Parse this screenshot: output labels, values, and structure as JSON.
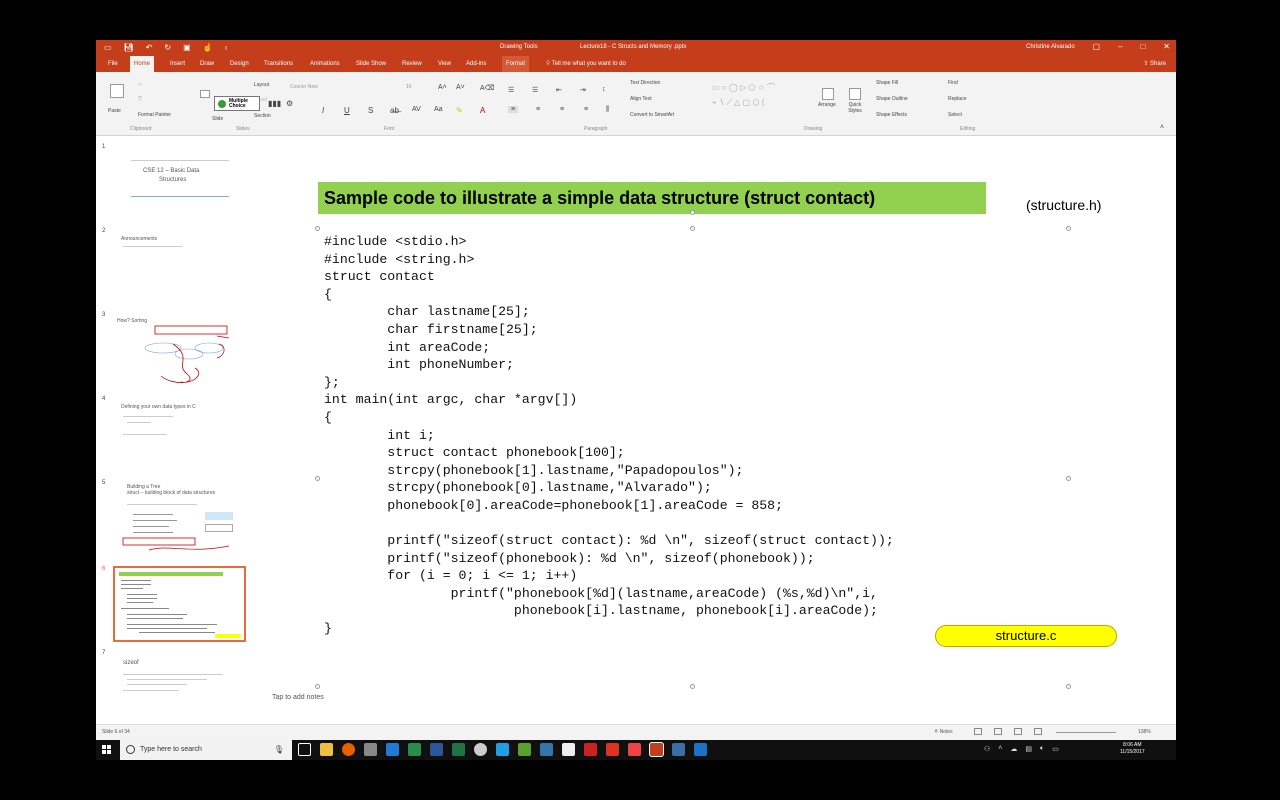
{
  "window": {
    "context_tab_label": "Drawing Tools",
    "title": "Lecture18 - C Structs and Memory .pptx",
    "user": "Christine Alvarado"
  },
  "tabs": [
    "File",
    "Home",
    "Insert",
    "Draw",
    "Design",
    "Transitions",
    "Animations",
    "Slide Show",
    "Review",
    "View",
    "Add-ins",
    "Format"
  ],
  "tell_me": "Tell me what you want to do",
  "share_label": "Share",
  "ribbon": {
    "paste": "Paste",
    "format_painter": "Format Painter",
    "layout": "Layout",
    "reset": "Reset",
    "section": "Section",
    "new_slide": "Slide",
    "multiple_choice": "Multiple Choice",
    "font_name": "Courier New",
    "font_size": "16",
    "text_direction": "Text Direction",
    "align_text": "Align Text",
    "convert_smartart": "Convert to SmartArt",
    "arrange": "Arrange",
    "quick_styles": "Quick Styles",
    "shape_fill": "Shape Fill",
    "shape_outline": "Shape Outline",
    "shape_effects": "Shape Effects",
    "find": "Find",
    "replace": "Replace",
    "select": "Select",
    "groups": [
      "Clipboard",
      "Slides",
      "Font",
      "Paragraph",
      "Drawing",
      "Editing"
    ]
  },
  "thumbnails": [
    {
      "num": "1",
      "lines": [
        "CSE 12 – Basic Data",
        "Structures"
      ]
    },
    {
      "num": "2",
      "lines": [
        "Announcements"
      ]
    },
    {
      "num": "3",
      "lines": [
        "How? Sorting"
      ]
    },
    {
      "num": "4",
      "lines": [
        "Defining your own data types in C"
      ]
    },
    {
      "num": "5",
      "lines": [
        "Building a Tree",
        "struct – building block of data structures"
      ]
    },
    {
      "num": "6",
      "lines": [
        "Sample code to illustrate a simple data structure (struct contact)"
      ]
    },
    {
      "num": "7",
      "lines": [
        "sizeof"
      ]
    }
  ],
  "slide": {
    "title": "Sample code to illustrate a simple data structure (struct contact)",
    "file_label": "(structure.h)",
    "code": "#include <stdio.h>\n#include <string.h>\nstruct contact\n{\n        char lastname[25];\n        char firstname[25];\n        int areaCode;\n        int phoneNumber;\n};\nint main(int argc, char *argv[])\n{\n        int i;\n        struct contact phonebook[100];\n        strcpy(phonebook[1].lastname,\"Papadopoulos\");\n        strcpy(phonebook[0].lastname,\"Alvarado\");\n        phonebook[0].areaCode=phonebook[1].areaCode = 858;\n\n        printf(\"sizeof(struct contact): %d \\n\", sizeof(struct contact));\n        printf(\"sizeof(phonebook): %d \\n\", sizeof(phonebook));\n        for (i = 0; i <= 1; i++)\n                printf(\"phonebook[%d](lastname,areaCode) (%s,%d)\\n\",i,\n                        phonebook[i].lastname, phonebook[i].areaCode);\n}",
    "badge": "structure.c"
  },
  "notes_hint": "Tap to add notes",
  "status": {
    "slide_count": "Slide 6 of 34",
    "notes_label": "Notes",
    "zoom": "138%"
  },
  "taskbar": {
    "search_placeholder": "Type here to search",
    "time": "8:06 AM",
    "date": "11/15/2017"
  },
  "colors": {
    "accent": "#c43e1c",
    "title_bg": "#92d050",
    "badge_bg": "#ffff00",
    "selected_thumb": "#e86b3c"
  }
}
